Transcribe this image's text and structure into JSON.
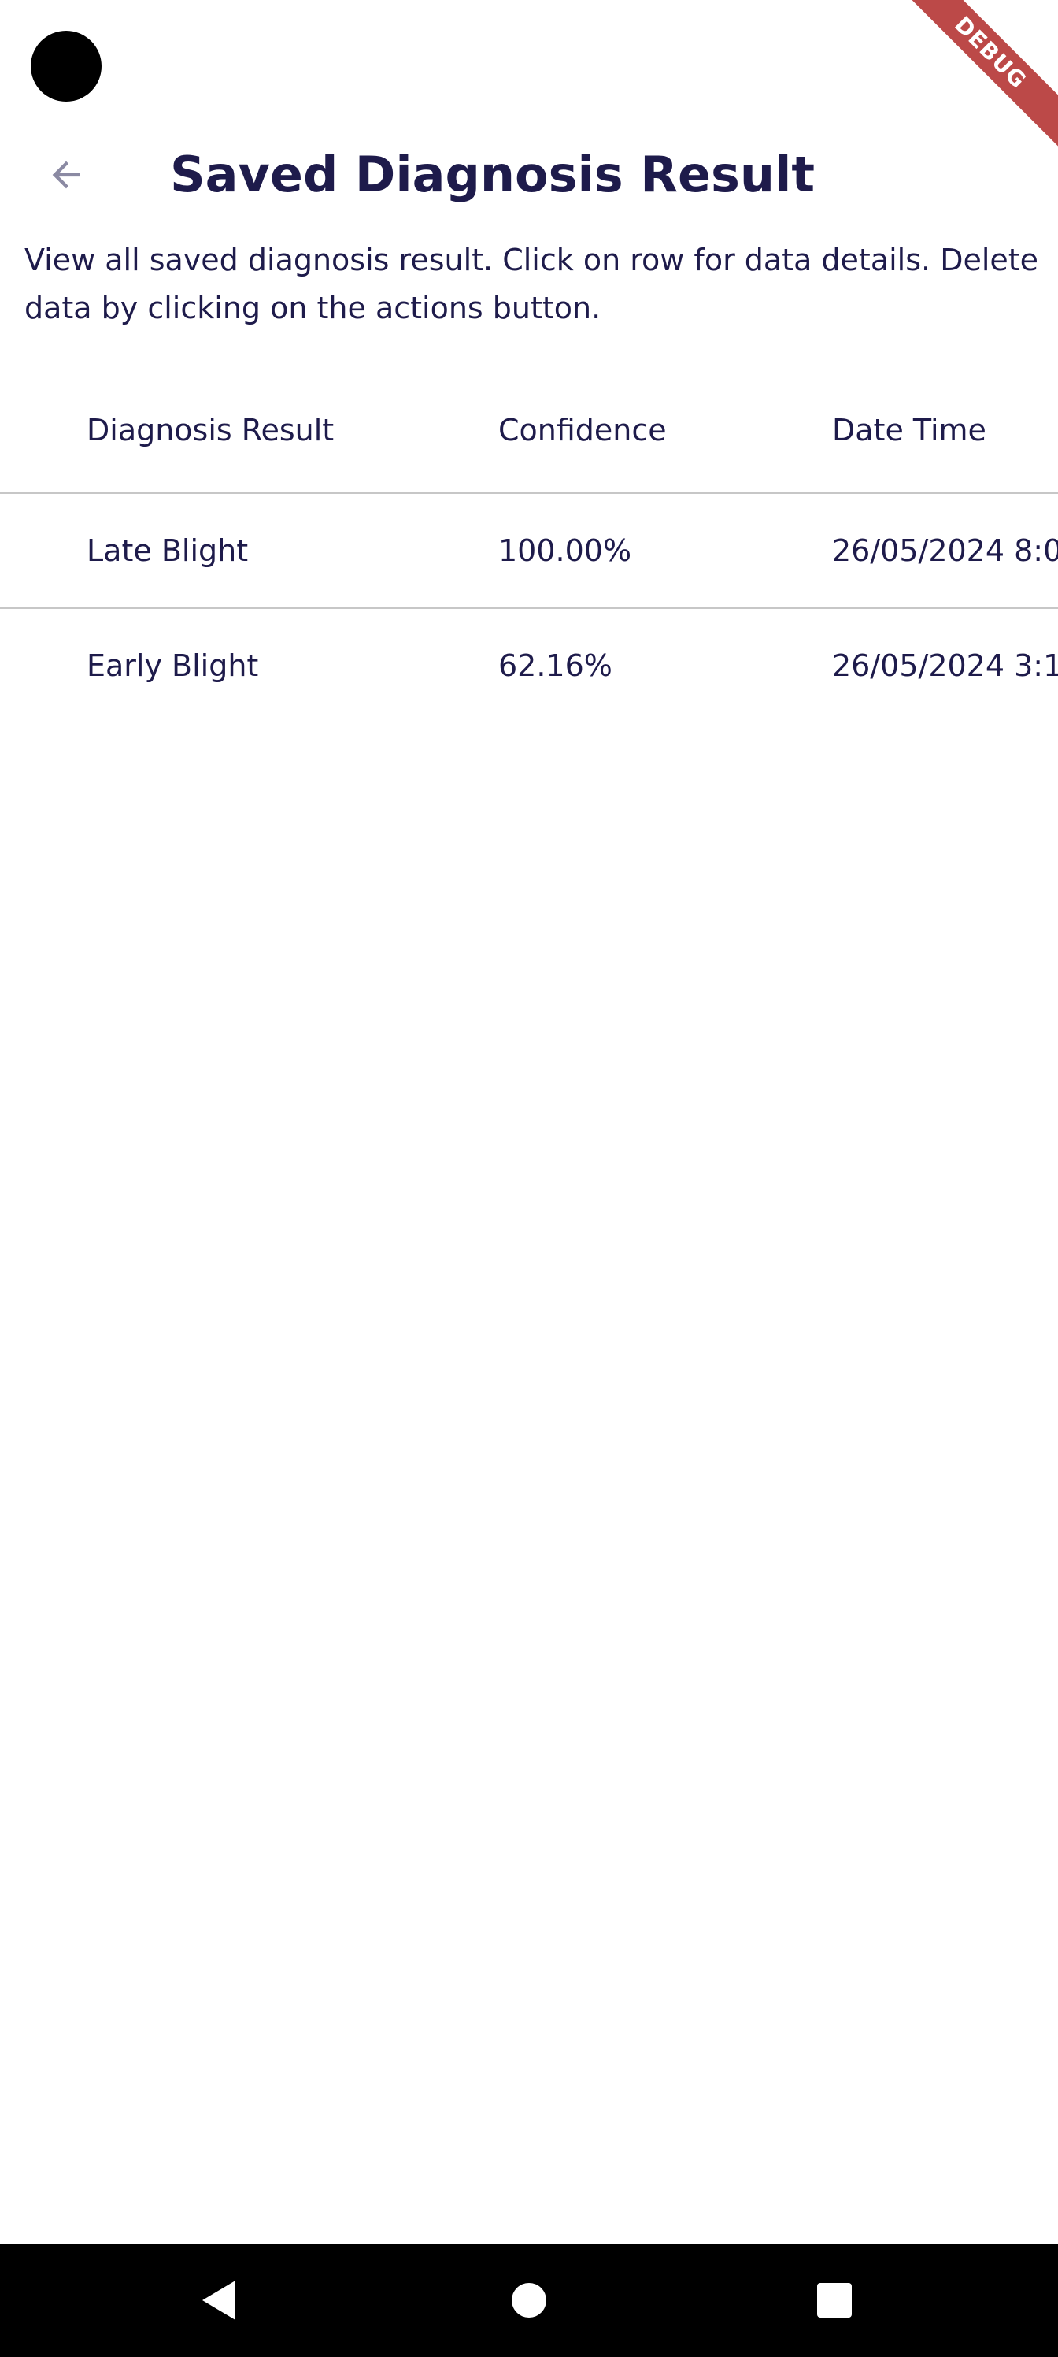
{
  "debug_banner": "DEBUG",
  "app_bar": {
    "back_icon": "arrow-back-icon",
    "title": "Saved Diagnosis Result"
  },
  "description": "View all saved diagnosis result. Click on row for data details. Delete data by clicking on the actions button.",
  "table": {
    "columns": [
      "Diagnosis Result",
      "Confidence",
      "Date Time"
    ],
    "rows": [
      {
        "diagnosis": "Late Blight",
        "confidence": "100.00%",
        "datetime": "26/05/2024 8:0"
      },
      {
        "diagnosis": "Early Blight",
        "confidence": "62.16%",
        "datetime": "26/05/2024 3:1"
      }
    ]
  },
  "nav_bar": {
    "back_icon": "triangle-back-icon",
    "home_icon": "circle-home-icon",
    "recents_icon": "square-recents-icon"
  },
  "colors": {
    "text": "#1e1b4b",
    "divider": "#c7c7c7",
    "back_arrow": "#8b8aa3",
    "debug_banner": "#b3302f"
  }
}
